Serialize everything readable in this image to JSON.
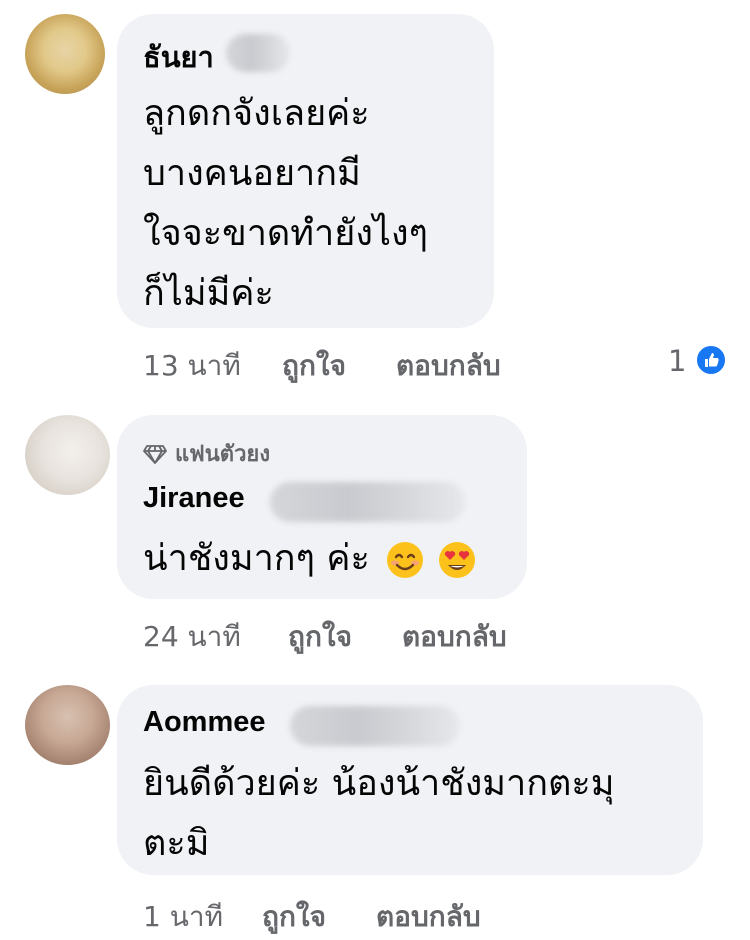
{
  "comments": [
    {
      "author": "ธันยา",
      "text_lines": [
        "ลูกดกจังเลยค่ะ",
        "บางคนอยากมี",
        "ใจจะขาดทำยังไงๆ",
        "ก็ไม่มีค่ะ"
      ],
      "time": "13 นาที",
      "like_label": "ถูกใจ",
      "reply_label": "ตอบกลับ",
      "reaction_count": "1"
    },
    {
      "badge": "แฟนตัวยง",
      "author": "Jiranee",
      "text": "น่าชังมากๆ ค่ะ",
      "emojis": [
        "smiling-face-icon",
        "heart-eyes-icon"
      ],
      "time": "24 นาที",
      "like_label": "ถูกใจ",
      "reply_label": "ตอบกลับ"
    },
    {
      "author": "Aommee",
      "text_lines": [
        "ยินดีด้วยค่ะ น้องน้าชังมากตะมุ",
        "ตะมิ"
      ],
      "time": "1 นาที",
      "like_label": "ถูกใจ",
      "reply_label": "ตอบกลับ"
    }
  ],
  "colors": {
    "bubble": "#f0f2f5",
    "meta_text": "#65676b",
    "like_blue": "#1877f2"
  }
}
